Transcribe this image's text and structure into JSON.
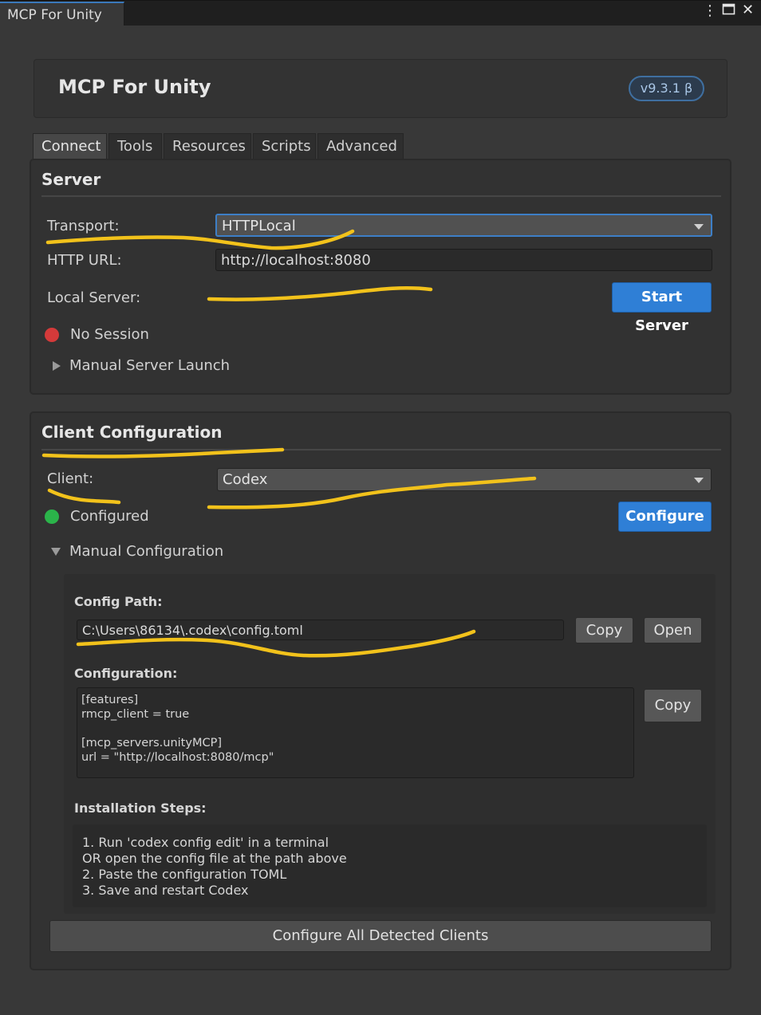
{
  "window": {
    "tab_title": "MCP For Unity",
    "menu_icon": "⋮",
    "maximize_icon": "🗖",
    "close_icon": "✕"
  },
  "header": {
    "title": "MCP For Unity",
    "version": "v9.3.1 β"
  },
  "tabs": [
    {
      "label": "Connect"
    },
    {
      "label": "Tools"
    },
    {
      "label": "Resources"
    },
    {
      "label": "Scripts"
    },
    {
      "label": "Advanced"
    }
  ],
  "server": {
    "title": "Server",
    "transport_label": "Transport:",
    "transport_value": "HTTPLocal",
    "url_label": "HTTP URL:",
    "url_value": "http://localhost:8080",
    "local_server_label": "Local Server:",
    "start_button": "Start Server",
    "status_text": "No Session",
    "status_color": "#d43a3a",
    "foldout_label": "Manual Server Launch"
  },
  "client": {
    "title": "Client Configuration",
    "client_label": "Client:",
    "client_value": "Codex",
    "status_text": "Configured",
    "status_color": "#2bb44a",
    "configure_button": "Configure",
    "foldout_label": "Manual Configuration",
    "config_path_label": "Config Path:",
    "config_path_value": "C:\\Users\\86134\\.codex\\config.toml",
    "copy_button": "Copy",
    "open_button": "Open",
    "configuration_label": "Configuration:",
    "configuration_text": "[features]\nrmcp_client = true\n\n[mcp_servers.unityMCP]\nurl = \"http://localhost:8080/mcp\"",
    "copy_config_button": "Copy",
    "install_label": "Installation Steps:",
    "install_steps": "1. Run 'codex config edit' in a terminal\nOR open the config file at the path above\n2. Paste the configuration TOML\n3. Save and restart Codex",
    "configure_all_button": "Configure All Detected Clients"
  },
  "annotation_color": "#f2c21b"
}
